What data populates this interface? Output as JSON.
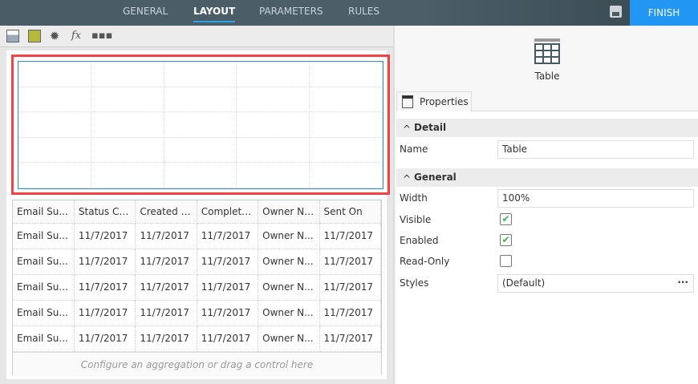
{
  "header": {
    "tabs": [
      "GENERAL",
      "LAYOUT",
      "PARAMETERS",
      "RULES"
    ],
    "active_tab": "LAYOUT",
    "finish_label": "FINISH"
  },
  "toolbar": {
    "icons": [
      "table-wizard-icon",
      "form-image-icon",
      "settings-icon",
      "function-icon",
      "more-icon"
    ],
    "fx": "fx"
  },
  "grid": {
    "columns": [
      "Email Su...",
      "Status Ch...",
      "Created On",
      "Complete...",
      "Owner Na...",
      "Sent On"
    ],
    "rows": [
      [
        "Email Su...",
        "11/7/2017",
        "11/7/2017",
        "11/7/2017",
        "Owner N...",
        "11/7/2017"
      ],
      [
        "Email Su...",
        "11/7/2017",
        "11/7/2017",
        "11/7/2017",
        "Owner N...",
        "11/7/2017"
      ],
      [
        "Email Su...",
        "11/7/2017",
        "11/7/2017",
        "11/7/2017",
        "Owner N...",
        "11/7/2017"
      ],
      [
        "Email Su...",
        "11/7/2017",
        "11/7/2017",
        "11/7/2017",
        "Owner N...",
        "11/7/2017"
      ],
      [
        "Email Su...",
        "11/7/2017",
        "11/7/2017",
        "11/7/2017",
        "Owner N...",
        "11/7/2017"
      ]
    ],
    "footer": "Configure an aggregation or drag a control here"
  },
  "panel": {
    "control_label": "Table",
    "tab": "Properties",
    "detail": {
      "title": "Detail",
      "name_label": "Name",
      "name_value": "Table"
    },
    "general": {
      "title": "General",
      "width_label": "Width",
      "width_value": "100%",
      "visible_label": "Visible",
      "visible": true,
      "enabled_label": "Enabled",
      "enabled": true,
      "readonly_label": "Read-Only",
      "readonly": false,
      "styles_label": "Styles",
      "styles_value": "(Default)",
      "styles_more": "···"
    }
  }
}
